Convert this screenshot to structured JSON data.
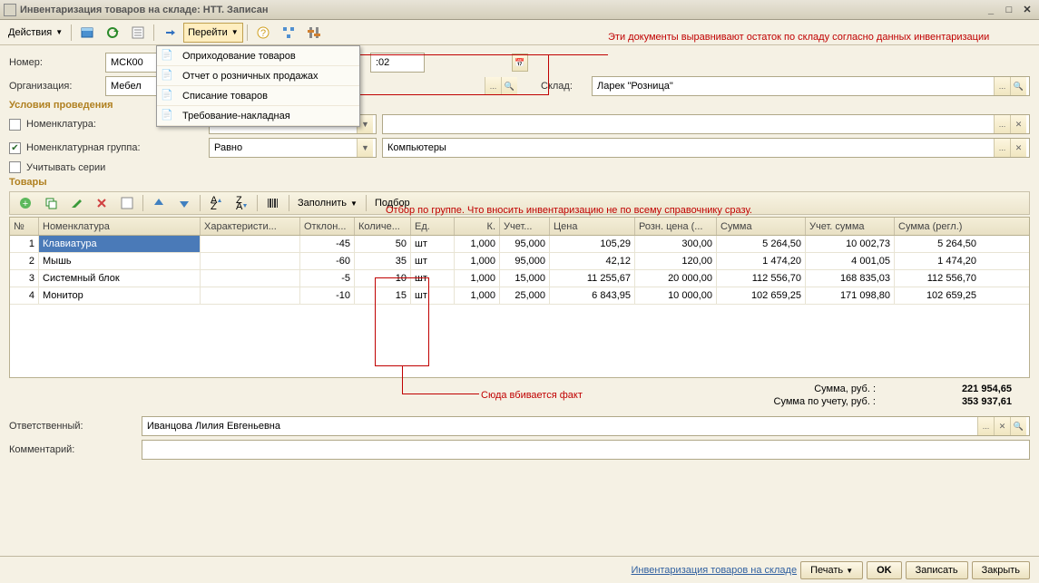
{
  "window": {
    "title": "Инвентаризация товаров на складе: НТТ. Записан"
  },
  "toolbar": {
    "actions": "Действия",
    "go": "Перейти"
  },
  "dropdown": {
    "items": [
      "Оприходование товаров",
      "Отчет о розничных продажах",
      "Списание товаров",
      "Требование-накладная"
    ]
  },
  "form": {
    "number_label": "Номер:",
    "number_value": "МСК00",
    "date_suffix": ":02",
    "org_label": "Организация:",
    "org_value": "Мебел",
    "sklad_label": "Склад:",
    "sklad_value": "Ларек \"Розница\""
  },
  "conditions": {
    "title": "Условия проведения",
    "nomenklatura": "Номенклатура:",
    "nom_group": "Номенклатурная группа:",
    "series": "Учитывать серии",
    "ravno": "Равно",
    "group_value": "Компьютеры"
  },
  "goods": {
    "title": "Товары",
    "fill": "Заполнить",
    "select": "Подбор"
  },
  "table": {
    "headers": {
      "n": "№",
      "nom": "Номенклатура",
      "har": "Характеристи...",
      "otk": "Отклон...",
      "kol": "Количе...",
      "ed": "Ед.",
      "k": "К.",
      "uch": "Учет...",
      "cena": "Цена",
      "rozn": "Розн. цена (...",
      "sum": "Сумма",
      "usum": "Учет. сумма",
      "regl": "Сумма (регл.)"
    },
    "rows": [
      {
        "n": "1",
        "nom": "Клавиатура",
        "har": "",
        "otk": "-45",
        "kol": "50",
        "ed": "шт",
        "k": "1,000",
        "uch": "95,000",
        "cena": "105,29",
        "rozn": "300,00",
        "sum": "5 264,50",
        "usum": "10 002,73",
        "regl": "5 264,50",
        "sel": true
      },
      {
        "n": "2",
        "nom": "Мышь",
        "har": "",
        "otk": "-60",
        "kol": "35",
        "ed": "шт",
        "k": "1,000",
        "uch": "95,000",
        "cena": "42,12",
        "rozn": "120,00",
        "sum": "1 474,20",
        "usum": "4 001,05",
        "regl": "1 474,20"
      },
      {
        "n": "3",
        "nom": "Системный блок",
        "har": "",
        "otk": "-5",
        "kol": "10",
        "ed": "шт",
        "k": "1,000",
        "uch": "15,000",
        "cena": "11 255,67",
        "rozn": "20 000,00",
        "sum": "112 556,70",
        "usum": "168 835,03",
        "regl": "112 556,70"
      },
      {
        "n": "4",
        "nom": "Монитор",
        "har": "",
        "otk": "-10",
        "kol": "15",
        "ed": "шт",
        "k": "1,000",
        "uch": "25,000",
        "cena": "6 843,95",
        "rozn": "10 000,00",
        "sum": "102 659,25",
        "usum": "171 098,80",
        "regl": "102 659,25"
      }
    ]
  },
  "totals": {
    "sum_label": "Сумма, руб. :",
    "sum_value": "221 954,65",
    "uchet_label": "Сумма по учету, руб. :",
    "uchet_value": "353 937,61"
  },
  "bottom_form": {
    "resp_label": "Ответственный:",
    "resp_value": "Иванцова Лилия Евгеньевна",
    "comment_label": "Комментарий:"
  },
  "bottom_bar": {
    "title": "Инвентаризация товаров на складе",
    "print": "Печать",
    "ok": "OK",
    "save": "Записать",
    "close": "Закрыть"
  },
  "annotations": {
    "a1": "Эти документы выравнивают остаток по складу согласно данных инвентаризации",
    "a2": "Отбор по группе. Что вносить инвентаризацию не по всему справочнику сразу.",
    "a3": "Сюда вбивается факт"
  }
}
